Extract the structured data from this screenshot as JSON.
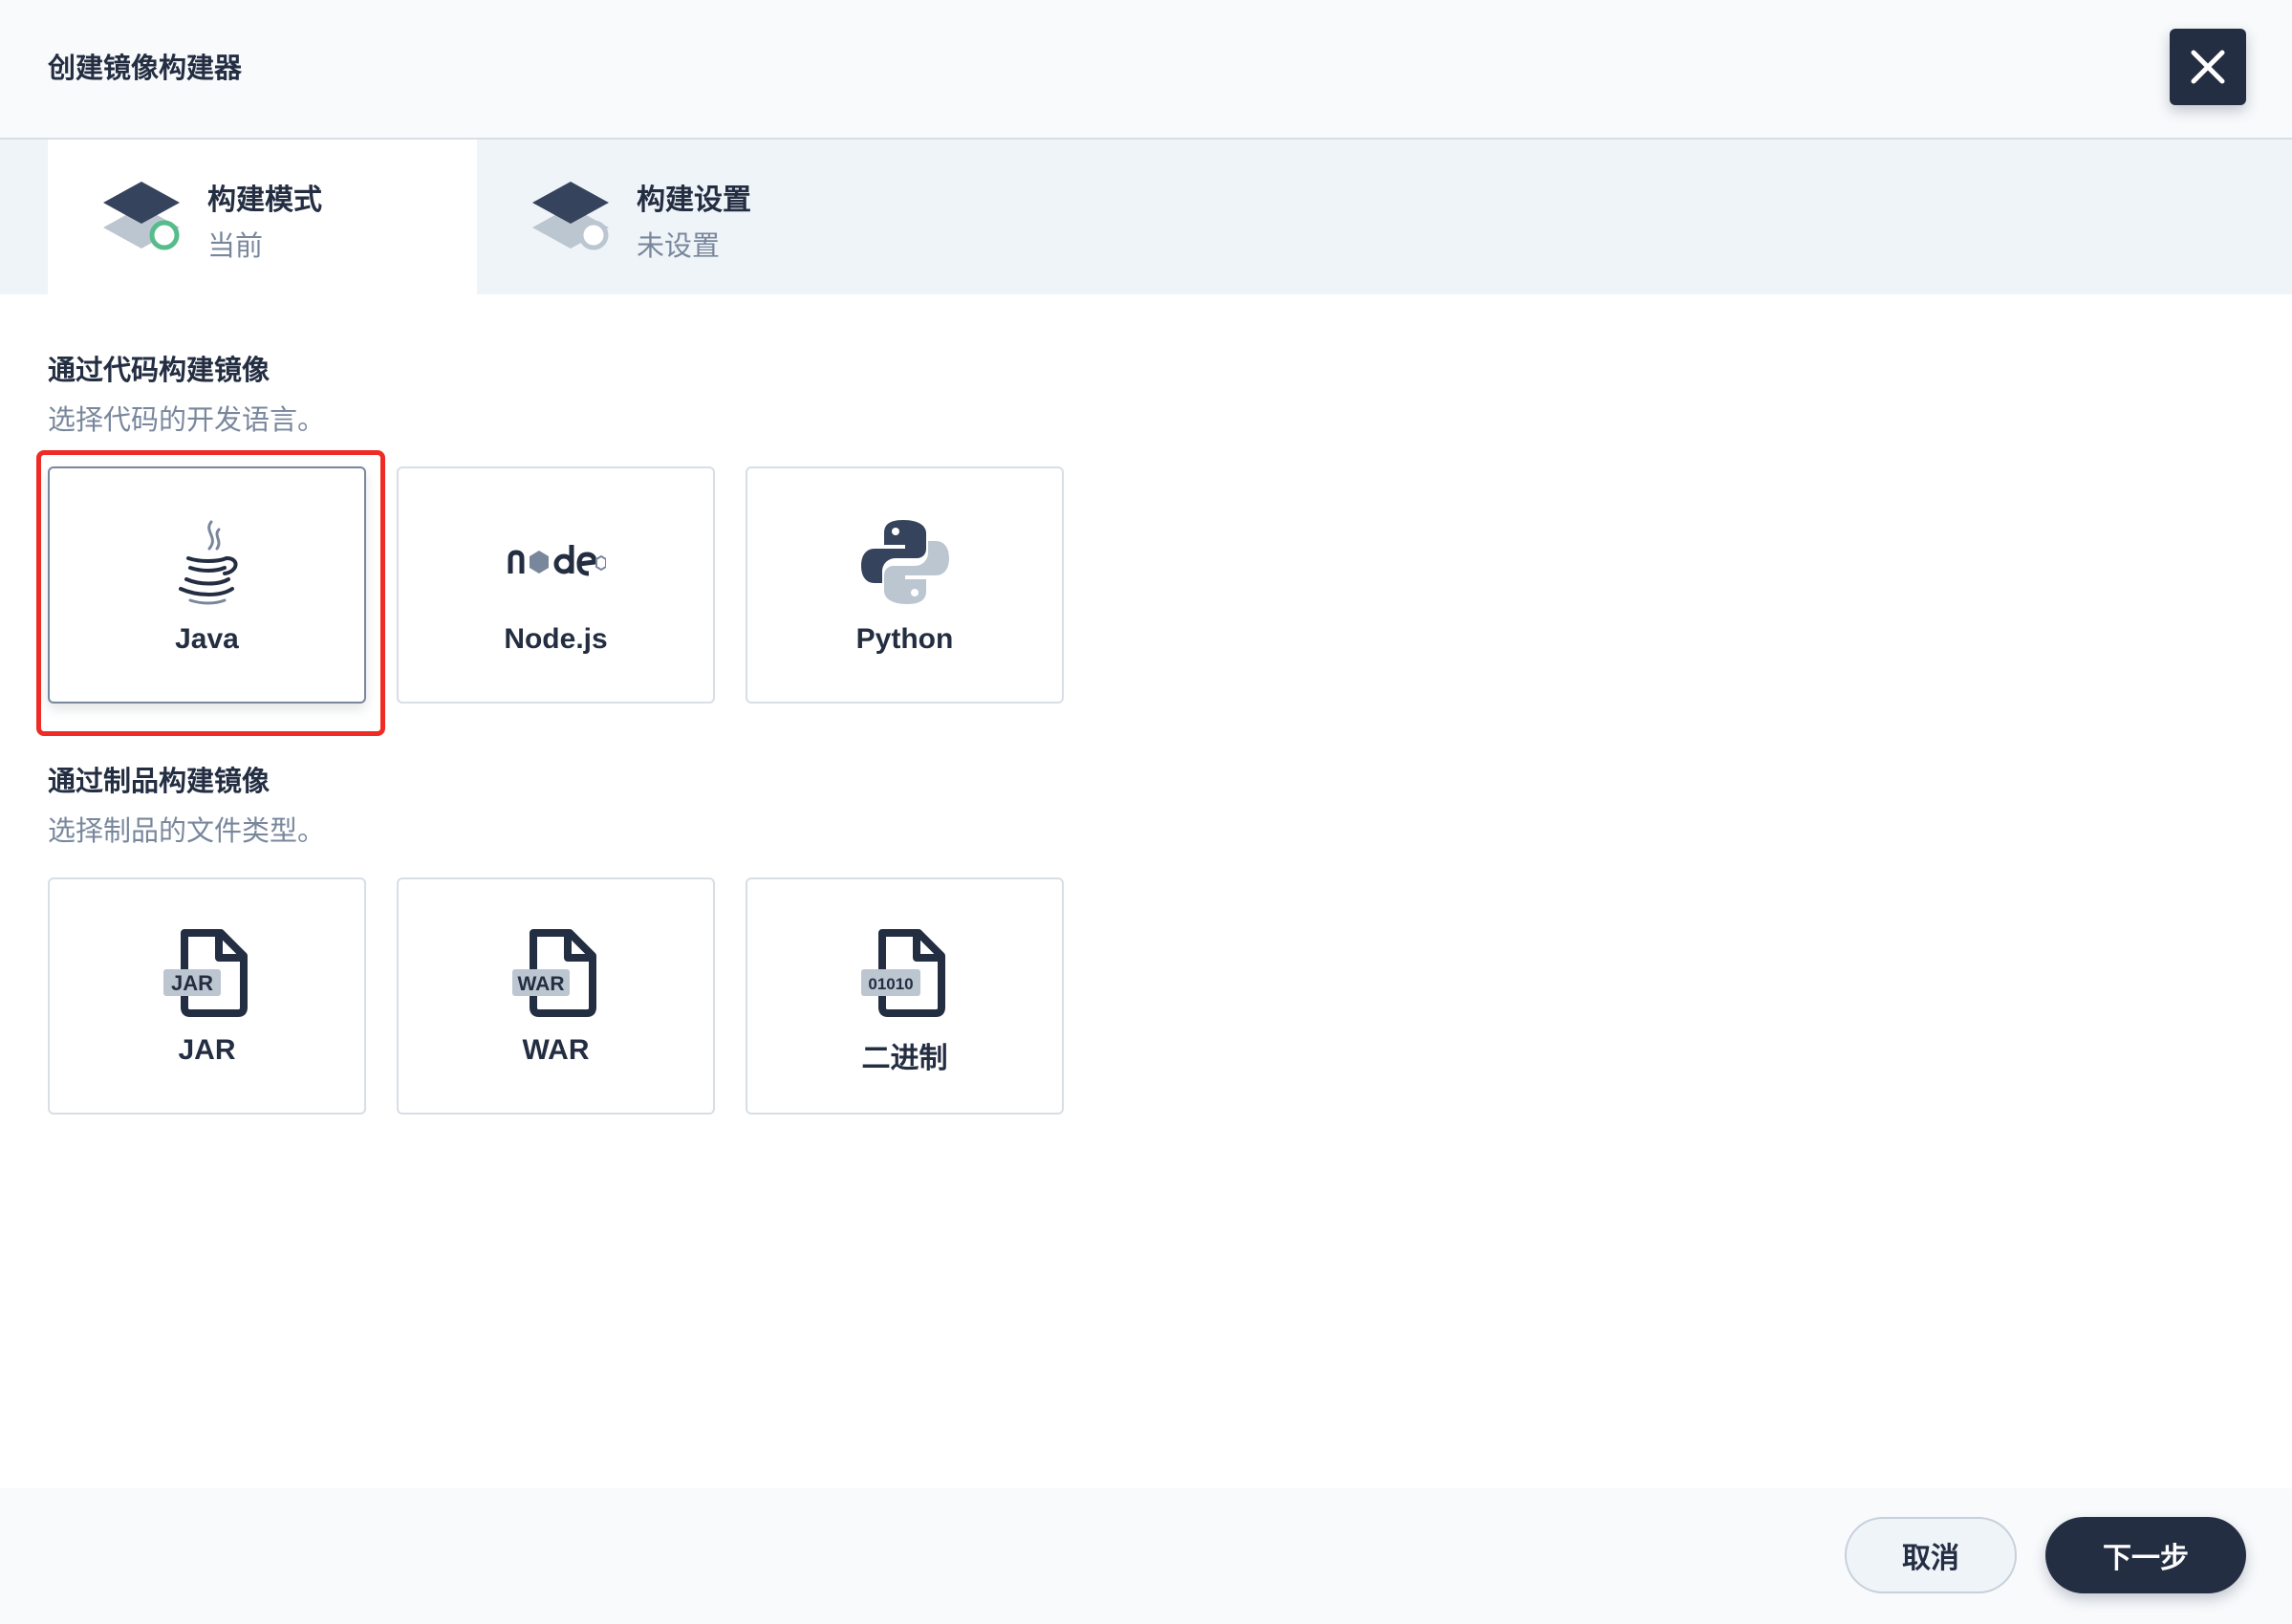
{
  "header": {
    "title": "创建镜像构建器"
  },
  "steps": [
    {
      "name": "构建模式",
      "status": "当前"
    },
    {
      "name": "构建设置",
      "status": "未设置"
    }
  ],
  "code_section": {
    "title": "通过代码构建镜像",
    "desc": "选择代码的开发语言。",
    "options": [
      {
        "label": "Java",
        "icon": "java-icon"
      },
      {
        "label": "Node.js",
        "icon": "nodejs-icon"
      },
      {
        "label": "Python",
        "icon": "python-icon"
      }
    ]
  },
  "artifact_section": {
    "title": "通过制品构建镜像",
    "desc": "选择制品的文件类型。",
    "options": [
      {
        "label": "JAR",
        "icon": "jar-file-icon",
        "badge": "JAR"
      },
      {
        "label": "WAR",
        "icon": "war-file-icon",
        "badge": "WAR"
      },
      {
        "label": "二进制",
        "icon": "binary-file-icon",
        "badge": "01010"
      }
    ]
  },
  "footer": {
    "cancel_label": "取消",
    "next_label": "下一步"
  },
  "colors": {
    "primary": "#242e42",
    "muted": "#79879c",
    "border": "#d8dee5",
    "active_ring": "#55bc8a",
    "highlight": "#ee2b24"
  }
}
